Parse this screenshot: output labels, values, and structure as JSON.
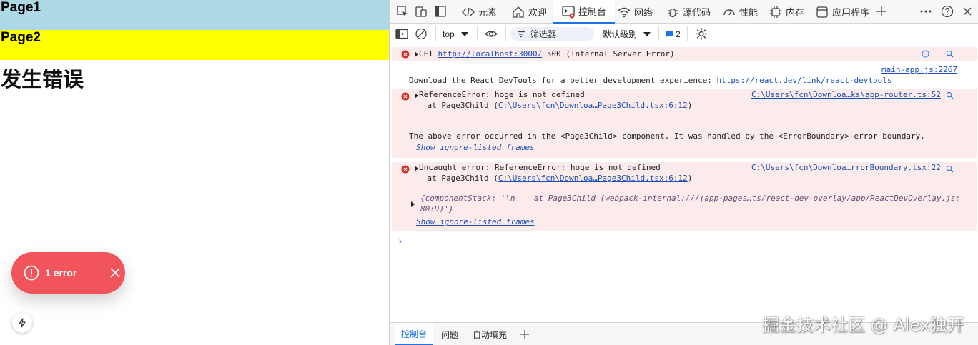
{
  "page": {
    "page1_label": "Page1",
    "page2_label": "Page2",
    "error_heading": "发生错误",
    "error_pill": {
      "count_label": "1 error",
      "icon": "alert-circle-icon"
    },
    "colors": {
      "page1_bg": "#add8e6",
      "page2_bg": "#ffff00",
      "error_pill": "#f2545b"
    }
  },
  "devtools": {
    "tabs": [
      {
        "label": "元素",
        "icon": "code-icon"
      },
      {
        "label": "欢迎",
        "icon": "home-icon"
      },
      {
        "label": "控制台",
        "icon": "console-icon",
        "active": true
      },
      {
        "label": "网络",
        "icon": "wifi-icon"
      },
      {
        "label": "源代码",
        "icon": "bug-icon"
      },
      {
        "label": "性能",
        "icon": "gauge-icon"
      },
      {
        "label": "内存",
        "icon": "chip-icon"
      },
      {
        "label": "应用程序",
        "icon": "app-window-icon"
      }
    ],
    "toolbar": {
      "context": "top",
      "filter_placeholder": "筛选器",
      "level": "默认级别",
      "issues_count": "2"
    },
    "messages": [
      {
        "type": "error",
        "prefix": "GET ",
        "url": "http://localhost:3000/",
        "suffix": " 500 (Internal Server Error)"
      },
      {
        "type": "info",
        "source": "main-app.js:2267",
        "text": "Download the React DevTools for a better development experience: ",
        "link": "https://react.dev/link/react-devtools"
      },
      {
        "type": "error",
        "title": "ReferenceError: hoge is not defined",
        "source": "C:\\Users\\fcn\\Downloa…ks\\app-router.ts:52",
        "stack_prefix": "    at Page3Child (",
        "stack_link": "C:\\Users\\fcn\\Downloa…Page3Child.tsx:6:12",
        "stack_suffix": ")",
        "note": "The above error occurred in the <Page3Child> component. It was handled by the <ErrorBoundary> error boundary.",
        "ignore_label": "Show ignore-listed frames"
      },
      {
        "type": "error",
        "title": "Uncaught error: ReferenceError: hoge is not defined",
        "source": "C:\\Users\\fcn\\Downloa…rrorBoundary.tsx:22",
        "stack_prefix": "    at Page3Child (",
        "stack_link": "C:\\Users\\fcn\\Downloa…Page3Child.tsx:6:12",
        "stack_suffix": ")",
        "object_line1": "{componentStack: '\\n    at Page3Child (webpack-internal:///(app-pages…ts/react-dev-overlay/app/ReactDevOverlay.js:",
        "object_line2": "80:9)'}",
        "ignore_label": "Show ignore-listed frames"
      }
    ],
    "prompt": "›",
    "drawer_tabs": [
      {
        "label": "控制台",
        "active": true
      },
      {
        "label": "问题"
      },
      {
        "label": "自动填充"
      }
    ]
  },
  "watermark": "掘金技术社区 @ Alex独开"
}
